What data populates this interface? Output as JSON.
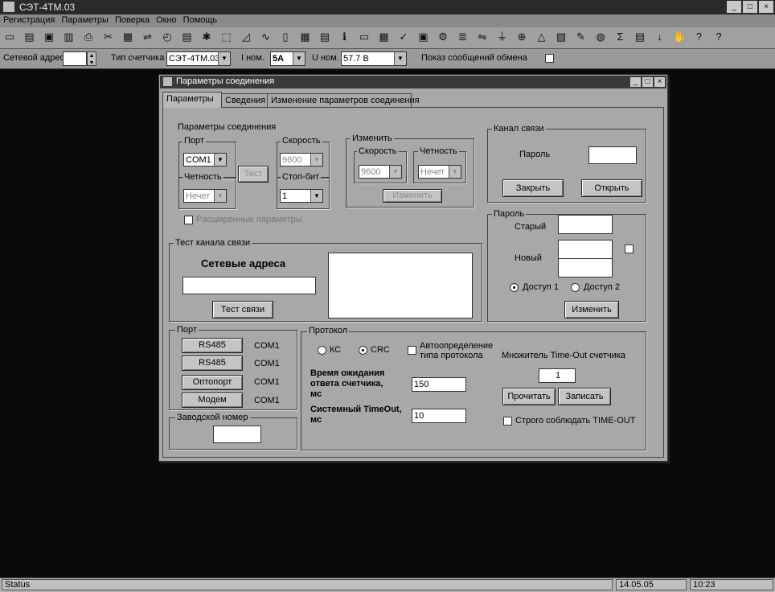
{
  "app": {
    "title": "СЭТ-4ТМ.03"
  },
  "window_controls": {
    "minimize": "_",
    "maximize": "□",
    "close": "×"
  },
  "menu": [
    "Регистрация",
    "Параметры",
    "Поверка",
    "Окно",
    "Помощь"
  ],
  "toolbar": {
    "icons": [
      "new-icon",
      "open-icon",
      "save-icon",
      "save-as-icon",
      "print-icon",
      "cut-icon",
      "meter-icon",
      "network-icon",
      "clock-icon",
      "calc-icon",
      "star-icon",
      "cursor-icon",
      "graph-icon",
      "wave-icon",
      "chart-icon",
      "table-icon",
      "doc-icon",
      "info-icon",
      "monitor-icon",
      "grid-icon",
      "check-icon",
      "energy-icon",
      "gear-icon",
      "list-icon",
      "link-icon",
      "plug-icon",
      "phase-icon",
      "warning-icon",
      "image-icon",
      "tool-icon",
      "globe-icon",
      "sum-icon",
      "book-icon",
      "arrow-icon",
      "hand-icon",
      "question-icon",
      "help-icon"
    ],
    "glyphs": [
      "▭",
      "▤",
      "▣",
      "▥",
      "⎙",
      "✂",
      "▦",
      "⇌",
      "◴",
      "▤",
      "✱",
      "⬚",
      "◿",
      "∿",
      "▯",
      "▦",
      "▤",
      "ℹ",
      "▭",
      "▦",
      "✓",
      "▣",
      "⚙",
      "≣",
      "⇋",
      "⏚",
      "⊕",
      "△",
      "▧",
      "✎",
      "◍",
      "Σ",
      "▤",
      "↓",
      "✋",
      "?",
      "?"
    ]
  },
  "addr_bar": {
    "net_address_label": "Сетевой адрес",
    "net_address_value": "",
    "meter_type_label": "Тип счетчика",
    "meter_type_value": "СЭТ-4ТМ.03",
    "i_nom_label": "I ном.",
    "i_nom_value": "5А",
    "u_nom_label": "U ном.",
    "u_nom_value": "57.7 В",
    "exchange_label": "Показ сообщений обмена"
  },
  "dialog": {
    "title": "Параметры соединения",
    "tabs": [
      "Параметры",
      "Сведения",
      "Изменение параметров соединения"
    ],
    "conn": {
      "group_title": "Параметры соединения",
      "port_label": "Порт",
      "port_value": "COM1",
      "speed_label": "Скорость",
      "speed_value": "9600",
      "parity_label": "Четность",
      "parity_value": "Нечет",
      "stopbit_label": "Стоп-бит",
      "stopbit_value": "1",
      "test_button": "Тест",
      "extended_label": "Расширенные параметры"
    },
    "change": {
      "group_title": "Изменить",
      "speed_label": "Скорость",
      "speed_value": "9600",
      "parity_label": "Четность",
      "parity_value": "Нечет",
      "apply_button": "Изменить"
    },
    "channel": {
      "group_title": "Канал связи",
      "password_label": "Пароль",
      "close_button": "Закрыть",
      "open_button": "Открыть"
    },
    "password": {
      "group_title": "Пароль",
      "old_label": "Старый",
      "new_label": "Новый",
      "access1_label": "Доступ 1",
      "access2_label": "Доступ 2",
      "change_button": "Изменить"
    },
    "test": {
      "group_title": "Тест канала связи",
      "addresses_label": "Сетевые адреса",
      "test_button": "Тест связи"
    },
    "ports": {
      "group_title": "Порт",
      "rows": [
        {
          "button": "RS485",
          "com": "COM1"
        },
        {
          "button": "RS485",
          "com": "COM1"
        },
        {
          "button": "Оптопорт",
          "com": "COM1"
        },
        {
          "button": "Модем",
          "com": "COM1"
        }
      ],
      "serial_title": "Заводской номер"
    },
    "protocol": {
      "group_title": "Протокол",
      "ks_label": "КС",
      "crc_label": "CRC",
      "auto_label_1": "Автоопределение",
      "auto_label_2": "типа протокола",
      "timeout_mult_label": "Множитель Time-Out счетчика",
      "timeout_mult_value": "1",
      "wait_label_1": "Время ожидания",
      "wait_label_2": "ответа счетчика,",
      "wait_label_3": "мс",
      "wait_value": "150",
      "sys_label_1": "Системный TimeOut,",
      "sys_label_2": "мс",
      "sys_value": "10",
      "read_button": "Прочитать",
      "write_button": "Записать",
      "strict_label": "Строго соблюдать TIME-OUT"
    }
  },
  "statusbar": {
    "status": "Status",
    "date": "14.05.05",
    "time": "10:23"
  }
}
